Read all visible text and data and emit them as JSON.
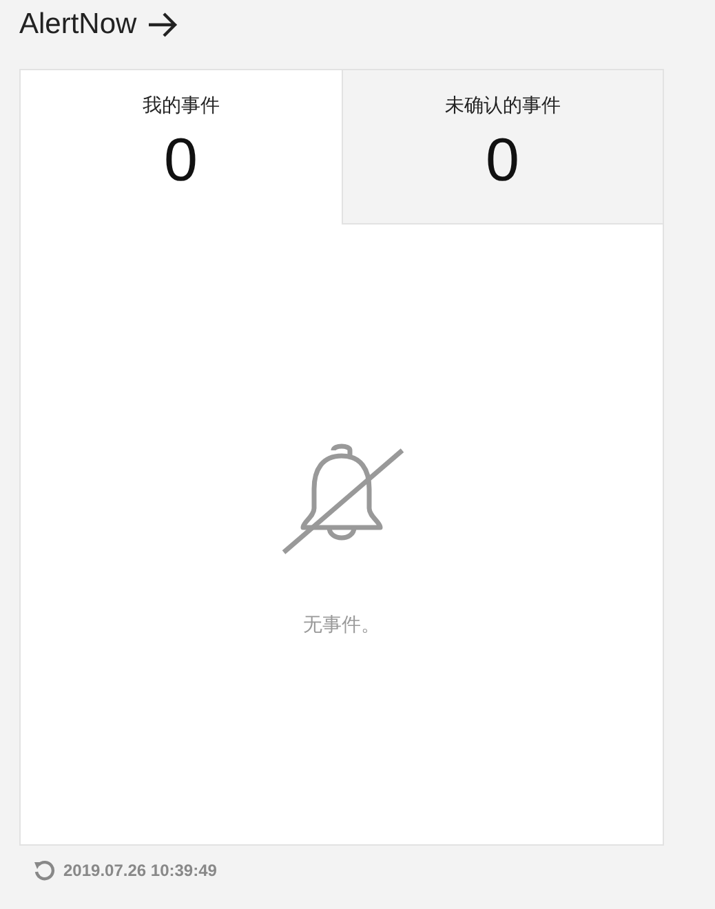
{
  "header": {
    "title": "AlertNow"
  },
  "tabs": [
    {
      "label": "我的事件",
      "count": "0",
      "selected": true
    },
    {
      "label": "未确认的事件",
      "count": "0",
      "selected": false
    }
  ],
  "empty_state": {
    "message": "无事件。"
  },
  "footer": {
    "timestamp": "2019.07.26 10:39:49"
  }
}
